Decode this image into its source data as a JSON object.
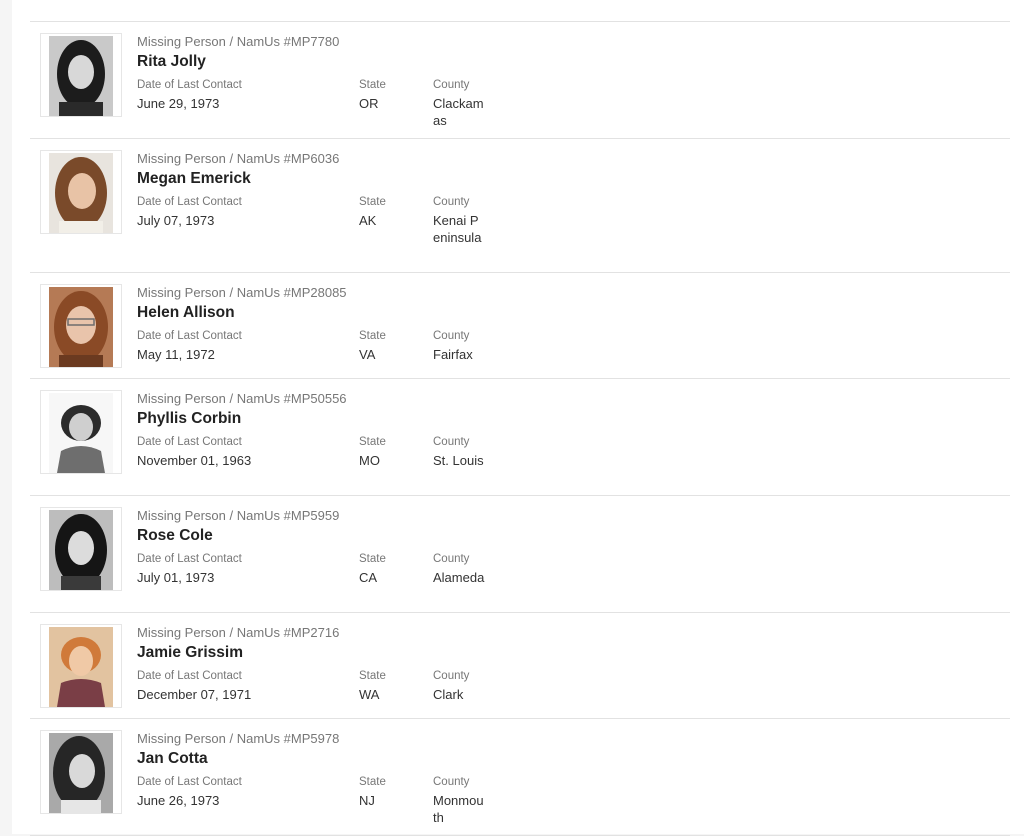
{
  "labels": {
    "date": "Date of Last Contact",
    "state": "State",
    "county": "County"
  },
  "cases": [
    {
      "caption": "Missing Person / NamUs #MP7780",
      "name": "Rita Jolly",
      "date": "June 29, 1973",
      "state": "OR",
      "county": "Clackamas",
      "photo": "bw"
    },
    {
      "caption": "Missing Person / NamUs #MP6036",
      "name": "Megan Emerick",
      "date": "July 07, 1973",
      "state": "AK",
      "county": "Kenai Peninsula",
      "photo": "color"
    },
    {
      "caption": "Missing Person / NamUs #MP28085",
      "name": "Helen Allison",
      "date": "May 11, 1972",
      "state": "VA",
      "county": "Fairfax",
      "photo": "color"
    },
    {
      "caption": "Missing Person / NamUs #MP50556",
      "name": "Phyllis Corbin",
      "date": "November 01, 1963",
      "state": "MO",
      "county": "St. Louis",
      "photo": "bw"
    },
    {
      "caption": "Missing Person / NamUs #MP5959",
      "name": "Rose Cole",
      "date": "July 01, 1973",
      "state": "CA",
      "county": "Alameda",
      "photo": "bw"
    },
    {
      "caption": "Missing Person / NamUs #MP2716",
      "name": "Jamie Grissim",
      "date": "December 07, 1971",
      "state": "WA",
      "county": "Clark",
      "photo": "color"
    },
    {
      "caption": "Missing Person / NamUs #MP5978",
      "name": "Jan Cotta",
      "date": "June 26, 1973",
      "state": "NJ",
      "county": "Monmouth",
      "photo": "bw"
    }
  ]
}
